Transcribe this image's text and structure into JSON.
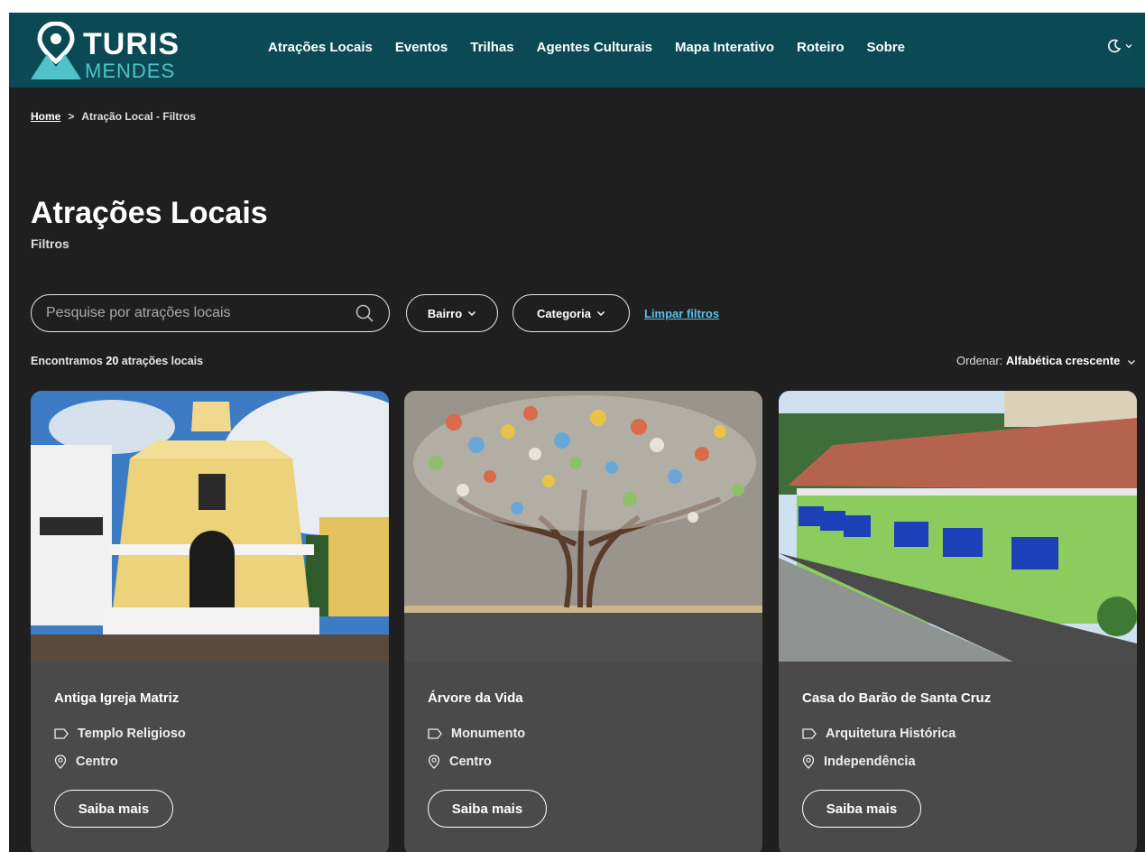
{
  "brand": {
    "line1": "TURIS",
    "line2": "MENDES"
  },
  "nav": [
    {
      "label": "Atrações Locais"
    },
    {
      "label": "Eventos"
    },
    {
      "label": "Trilhas"
    },
    {
      "label": "Agentes Culturais"
    },
    {
      "label": "Mapa Interativo"
    },
    {
      "label": "Roteiro"
    },
    {
      "label": "Sobre"
    }
  ],
  "theme_toggle": {
    "icon": "moon-icon"
  },
  "breadcrumb": {
    "home": "Home",
    "current": "Atração Local - Filtros"
  },
  "page": {
    "title": "Atrações Locais",
    "subtitle": "Filtros"
  },
  "search": {
    "placeholder": "Pesquise por atrações locais",
    "value": ""
  },
  "filters": {
    "bairro": "Bairro",
    "categoria": "Categoria",
    "clear": "Limpar filtros"
  },
  "results": {
    "prefix": "Encontramos",
    "count": "20",
    "suffix": "atrações locais"
  },
  "sort": {
    "label": "Ordenar:",
    "value": "Alfabética crescente"
  },
  "cards": [
    {
      "title": "Antiga Igreja Matriz",
      "category": "Templo Religioso",
      "neighborhood": "Centro",
      "button": "Saiba mais"
    },
    {
      "title": "Árvore da Vida",
      "category": "Monumento",
      "neighborhood": "Centro",
      "button": "Saiba mais"
    },
    {
      "title": "Casa do Barão de Santa Cruz",
      "category": "Arquitetura Histórica",
      "neighborhood": "Independência",
      "button": "Saiba mais"
    }
  ],
  "colors": {
    "header": "#0b4a55",
    "background": "#1f1f1f",
    "card": "#4a4a4a",
    "link": "#5bc0ee",
    "logo_accent": "#4fc3c9"
  }
}
